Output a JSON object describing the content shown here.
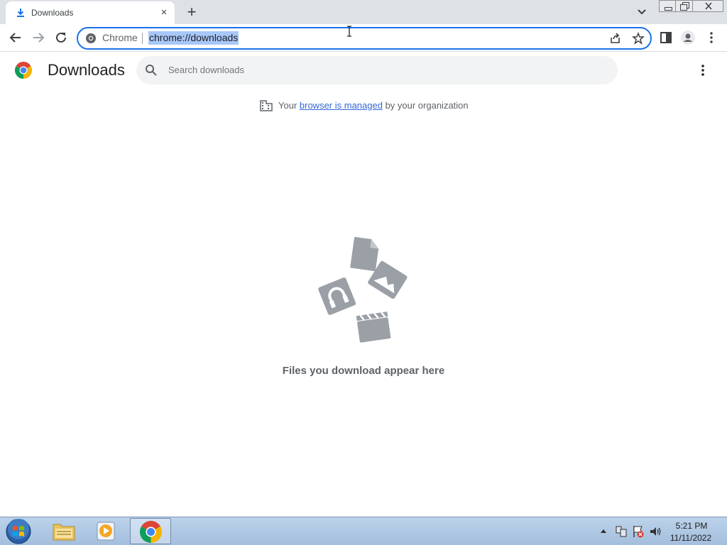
{
  "tab": {
    "title": "Downloads",
    "close_glyph": "×"
  },
  "newtab_glyph": "+",
  "omnibox": {
    "chip": "Chrome",
    "url": "chrome://downloads"
  },
  "page": {
    "title": "Downloads",
    "search_placeholder": "Search downloads",
    "managed_prefix": "Your ",
    "managed_link": "browser is managed",
    "managed_suffix": " by your organization",
    "empty_message": "Files you download appear here"
  },
  "taskbar": {
    "time": "5:21 PM",
    "date": "11/11/2022"
  },
  "colors": {
    "accent": "#1a73e8",
    "tabstrip": "#dee1e6",
    "url_highlight": "#a8c7fa",
    "search_bg": "#f1f3f4"
  },
  "icons": [
    "download-icon",
    "close-icon",
    "plus-icon",
    "chevron-down-icon",
    "back-icon",
    "forward-icon",
    "reload-icon",
    "share-icon",
    "star-icon",
    "side-panel-icon",
    "profile-icon",
    "menu-icon",
    "search-icon",
    "building-icon",
    "windows-start-icon",
    "file-explorer-icon",
    "media-player-icon",
    "chrome-icon"
  ]
}
